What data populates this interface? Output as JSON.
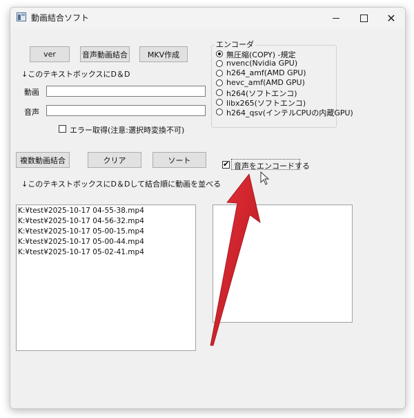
{
  "window": {
    "title": "動画結合ソフト",
    "controls": {
      "minimize": "",
      "maximize": "",
      "close": "✕"
    }
  },
  "top_buttons": {
    "ver": "ver",
    "audio_video_merge": "音声動画結合",
    "mkv": "MKV作成"
  },
  "dd_hint": "↓このテキストボックスにD＆D",
  "fields": {
    "video_label": "動画",
    "video_value": "",
    "audio_label": "音声",
    "audio_value": ""
  },
  "error_checkbox": {
    "label": "エラー取得(注意:選択時変換不可)",
    "checked": false
  },
  "encoder": {
    "title": "エンコーダ",
    "options": [
      {
        "label": "無圧縮(COPY) -規定",
        "selected": true
      },
      {
        "label": "nvenc(Nvidia GPU)",
        "selected": false
      },
      {
        "label": "h264_amf(AMD GPU)",
        "selected": false
      },
      {
        "label": "hevc_amf(AMD GPU)",
        "selected": false
      },
      {
        "label": "h264(ソフトエンコ)",
        "selected": false
      },
      {
        "label": "libx265(ソフトエンコ)",
        "selected": false
      },
      {
        "label": "h264_qsv(インテルCPUの内蔵GPU)",
        "selected": false
      }
    ]
  },
  "middle_buttons": {
    "multi_merge": "複数動画結合",
    "clear": "クリア",
    "sort": "ソート"
  },
  "encode_audio_checkbox": {
    "label": "音声をエンコードする",
    "checked": true
  },
  "list_hint": "↓このテキストボックスにD＆Dして結合順に動画を並べる",
  "file_list": [
    "K:¥test¥2025-10-17 04-55-38.mp4",
    "K:¥test¥2025-10-17 04-56-32.mp4",
    "K:¥test¥2025-10-17 05-00-15.mp4",
    "K:¥test¥2025-10-17 05-00-44.mp4",
    "K:¥test¥2025-10-17 05-02-41.mp4"
  ],
  "colors": {
    "annotation_arrow": "#d0202a",
    "window_bg": "#f0f0f0"
  }
}
